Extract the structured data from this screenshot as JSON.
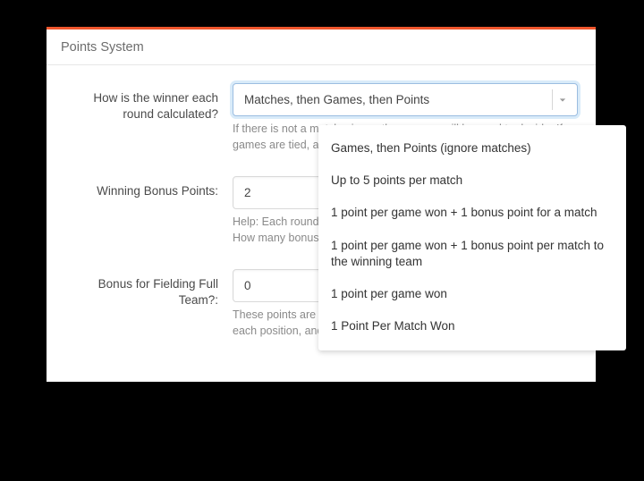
{
  "header": {
    "title": "Points System"
  },
  "fields": {
    "winner": {
      "label": "How is the winner each round calculated?",
      "value": "Matches, then Games, then Points",
      "help": "If there is not a match winner, then games will be used to decide. If games are tied, a draw is declared."
    },
    "bonus": {
      "label": "Winning Bonus Points:",
      "value": "2",
      "help": "Help: Each round is calculated to determine a winner and loser. How many bonus points does the winner get?"
    },
    "fullteam": {
      "label": "Bonus for Fielding Full Team?:",
      "value": "0",
      "help": "These points are awarded when a team fields different players in each position, and plays all matches."
    }
  },
  "dropdown": {
    "options": [
      "Games, then Points (ignore matches)",
      "Up to 5 points per match",
      "1 point per game won + 1 bonus point for a match",
      "1 point per game won + 1 bonus point per match to the winning team",
      "1 point per game won",
      "1 Point Per Match Won"
    ]
  }
}
